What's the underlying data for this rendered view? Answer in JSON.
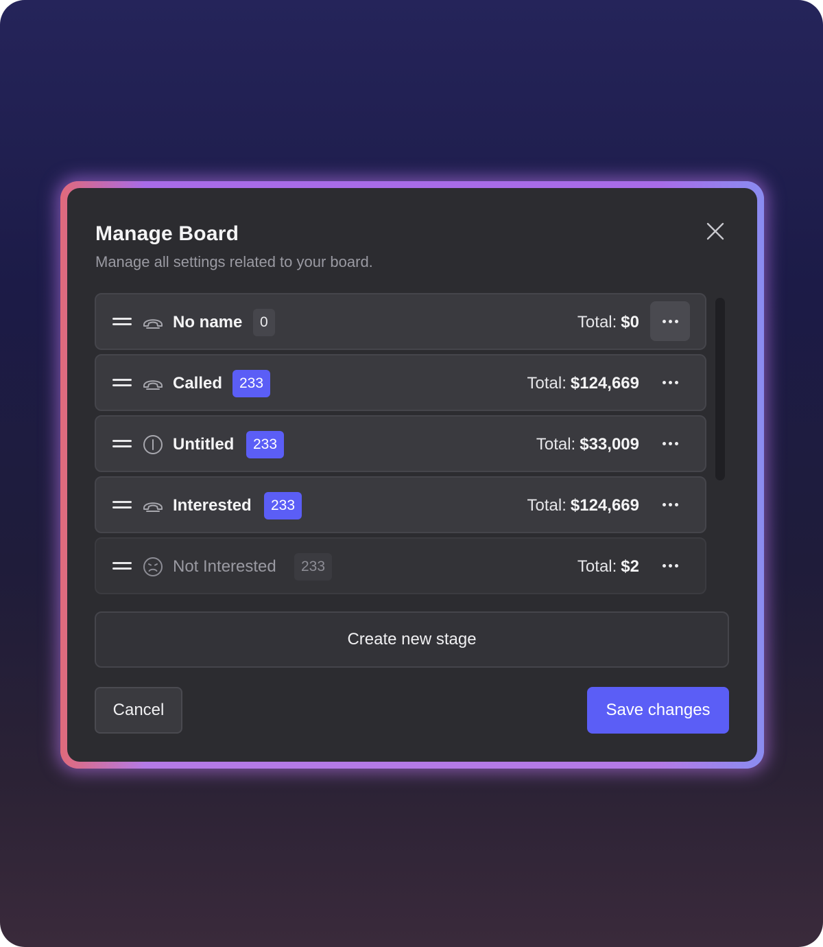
{
  "modal": {
    "title": "Manage Board",
    "subtitle": "Manage all settings related to your board."
  },
  "stages": [
    {
      "label": "No name",
      "count": "0",
      "total_label": "Total:",
      "total_value": "$0",
      "icon": "phone-icon"
    },
    {
      "label": "Called",
      "count": "233",
      "total_label": "Total:",
      "total_value": "$124,669",
      "icon": "phone-icon"
    },
    {
      "label": "Untitled",
      "count": "233",
      "total_label": "Total:",
      "total_value": "$33,009",
      "icon": "info-circle-icon"
    },
    {
      "label": "Interested",
      "count": "233",
      "total_label": "Total:",
      "total_value": "$124,669",
      "icon": "phone-icon"
    },
    {
      "label": "Not Interested",
      "count": "233",
      "total_label": "Total:",
      "total_value": "$2",
      "icon": "sad-face-icon"
    }
  ],
  "actions": {
    "create_label": "Create new stage",
    "cancel_label": "Cancel",
    "save_label": "Save changes"
  },
  "colors": {
    "accent": "#5b5ef6",
    "modal_bg": "#2c2c30",
    "row_bg": "#3a3a3f"
  }
}
